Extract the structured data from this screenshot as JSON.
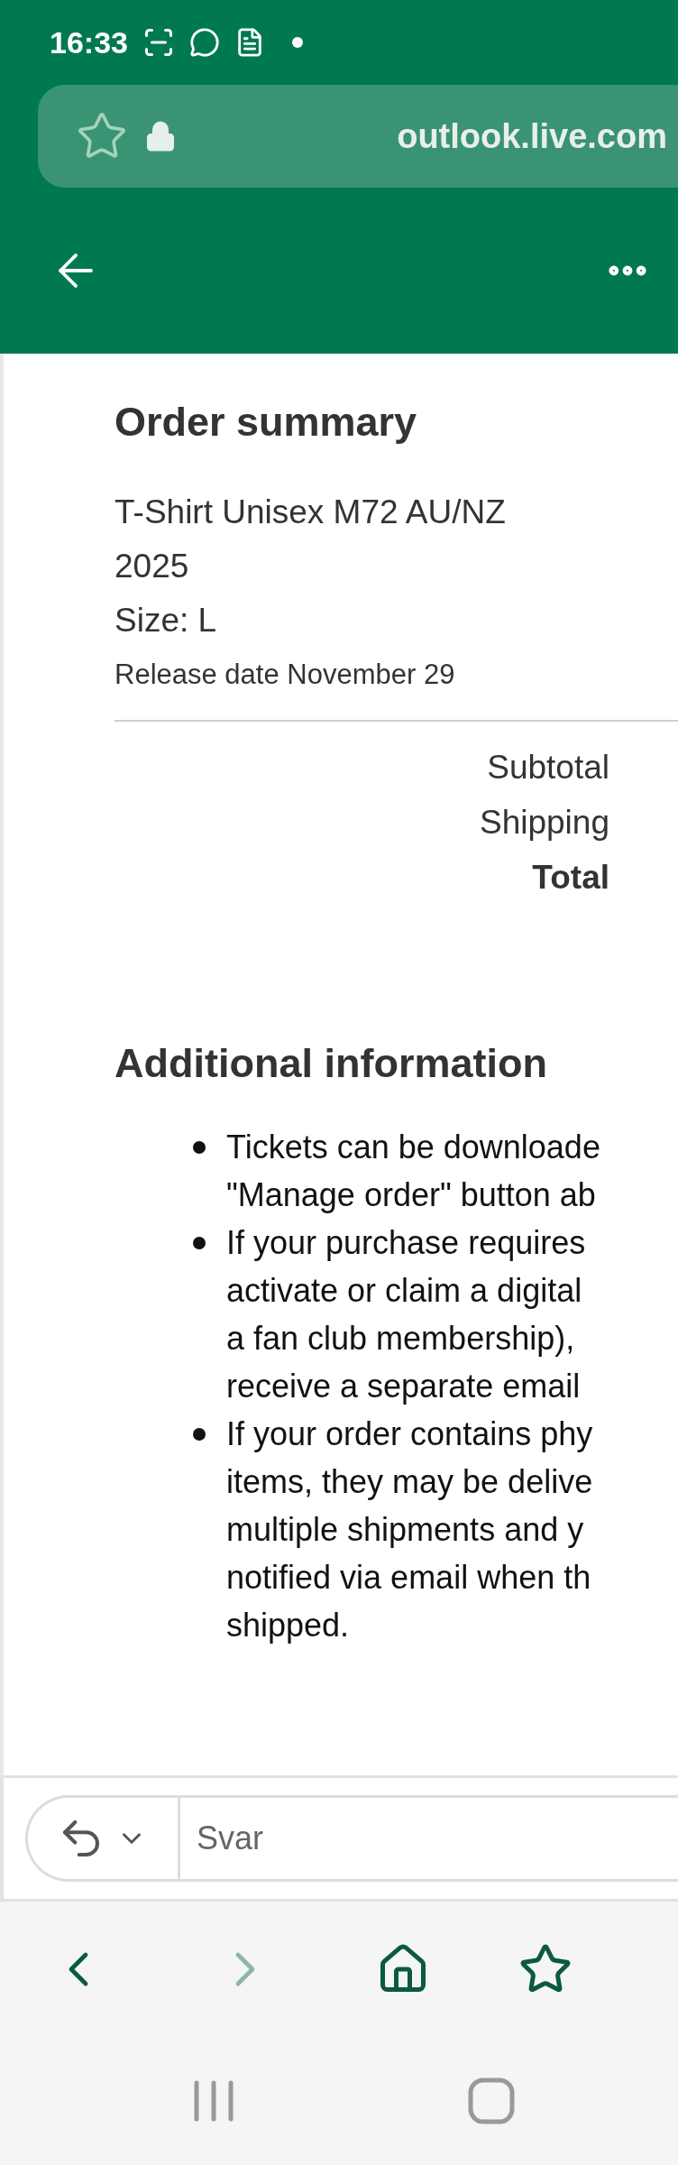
{
  "status_bar": {
    "time": "16:33"
  },
  "browser": {
    "url": "outlook.live.com",
    "bookmarked": false
  },
  "order_summary": {
    "title": "Order summary",
    "item_lines": [
      "T-Shirt Unisex M72 AU/NZ",
      "2025",
      "Size: L"
    ],
    "release": "Release date November 29",
    "totals": [
      {
        "label": "Subtotal",
        "bold": false
      },
      {
        "label": "Shipping",
        "bold": false
      },
      {
        "label": "Total",
        "bold": true
      }
    ]
  },
  "additional": {
    "title": "Additional information",
    "bullets": [
      {
        "lines": [
          "Tickets can be downloade",
          "\"Manage order\" button ab"
        ]
      },
      {
        "lines": [
          "If your purchase requires",
          "activate or claim a digital",
          "a fan club membership),",
          "receive a separate email"
        ]
      },
      {
        "lines": [
          "If your order contains phy",
          "items, they may be delive",
          "multiple shipments and y",
          "notified via email when th",
          "shipped."
        ]
      }
    ]
  },
  "reply": {
    "placeholder": "Svar"
  },
  "toolbar": {
    "back_enabled": true,
    "forward_enabled": false
  }
}
